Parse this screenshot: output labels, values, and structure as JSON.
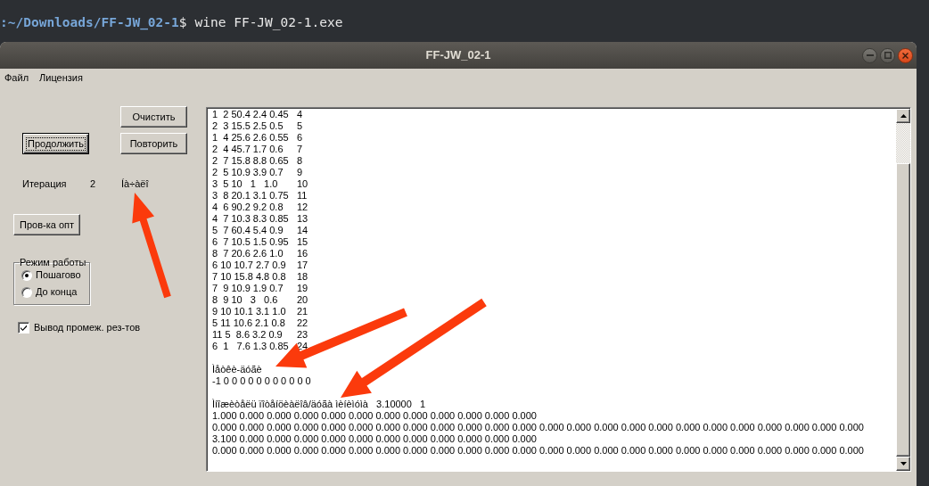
{
  "terminal": {
    "path": ":~/Downloads/FF-JW_02-1",
    "prompt": "$",
    "command": "wine FF-JW_02-1.exe"
  },
  "window": {
    "title": "FF-JW_02-1"
  },
  "menu": [
    "Файл",
    "Лицензия"
  ],
  "controls": {
    "clear_button": {
      "label": "Очистить",
      "focused": false
    },
    "continue_button": {
      "label": "Продолжить",
      "focused": true
    },
    "repeat_button": {
      "label": "Повторить",
      "focused": false
    },
    "iteration": {
      "label": "Итерация",
      "value": "2",
      "status": "Íà÷àëî"
    },
    "check_button": {
      "label": "Пров-ка опт",
      "focused": false
    },
    "mode_group": {
      "title": "Режим работы",
      "options": [
        {
          "label": "Пошагово",
          "selected": true
        },
        {
          "label": "До конца",
          "selected": false
        }
      ]
    },
    "intermediate_output": {
      "label": "Вывод промеж. рез-тов",
      "checked": true
    }
  },
  "output": {
    "edges": [
      {
        "text": "1  2 50.4 2.4 0.45",
        "index": "4"
      },
      {
        "text": "2  3 15.5 2.5 0.5",
        "index": "5"
      },
      {
        "text": "1  4 25.6 2.6 0.55",
        "index": "6"
      },
      {
        "text": "2  4 45.7 1.7 0.6",
        "index": "7"
      },
      {
        "text": "2  7 15.8 8.8 0.65",
        "index": "8"
      },
      {
        "text": "2  5 10.9 3.9 0.7",
        "index": "9"
      },
      {
        "text": "3  5 10   1   1.0",
        "index": "10"
      },
      {
        "text": "3  8 20.1 3.1 0.75",
        "index": "11"
      },
      {
        "text": "4  6 90.2 9.2 0.8",
        "index": "12"
      },
      {
        "text": "4  7 10.3 8.3 0.85",
        "index": "13"
      },
      {
        "text": "5  7 60.4 5.4 0.9",
        "index": "14"
      },
      {
        "text": "6  7 10.5 1.5 0.95",
        "index": "15"
      },
      {
        "text": "8  7 20.6 2.6 1.0",
        "index": "16"
      },
      {
        "text": "6 10 10.7 2.7 0.9",
        "index": "17"
      },
      {
        "text": "7 10 15.8 4.8 0.8",
        "index": "18"
      },
      {
        "text": "7  9 10.9 1.9 0.7",
        "index": "19"
      },
      {
        "text": "8  9 10   3   0.6",
        "index": "20"
      },
      {
        "text": "9 10 10.1 3.1 1.0",
        "index": "21"
      },
      {
        "text": "5 11 10.6 2.1 0.8",
        "index": "22"
      },
      {
        "text": "11 5  8.6 3.2 0.9",
        "index": "23"
      },
      {
        "text": "6  1   7.6 1.3 0.85",
        "index": "24"
      }
    ],
    "labels_title": "Ìåòêè-äóãè",
    "labels": "-1 0 0 0 0 0 0 0 0 0 0 0",
    "multiplier": "Ìíîæèòåëü ïîòåíöèàëîâ/äóãà ìèíèìóìà   3.10000   1",
    "matrix_rows": [
      "1.000 0.000 0.000 0.000 0.000 0.000 0.000 0.000 0.000 0.000 0.000 0.000",
      "0.000 0.000 0.000 0.000 0.000 0.000 0.000 0.000 0.000 0.000 0.000 0.000 0.000 0.000 0.000 0.000 0.000 0.000 0.000 0.000 0.000 0.000 0.000 0.000",
      "3.100 0.000 0.000 0.000 0.000 0.000 0.000 0.000 0.000 0.000 0.000 0.000",
      "0.000 0.000 0.000 0.000 0.000 0.000 0.000 0.000 0.000 0.000 0.000 0.000 0.000 0.000 0.000 0.000 0.000 0.000 0.000 0.000 0.000 0.000 0.000 0.000"
    ]
  }
}
